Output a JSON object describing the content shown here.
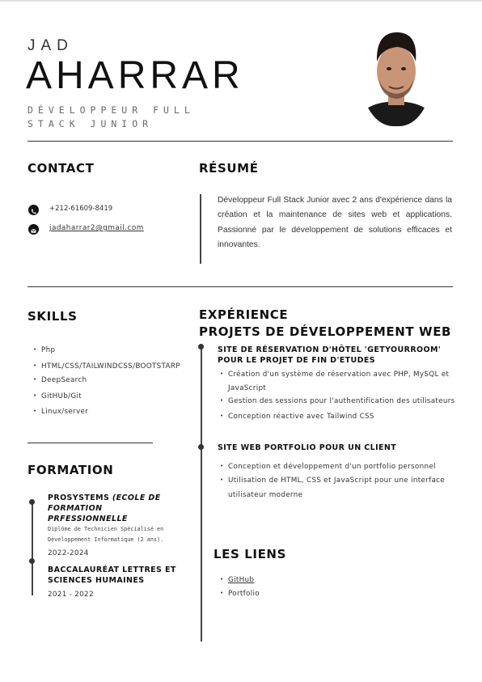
{
  "header": {
    "first_name": "JAD",
    "last_name": "AHARRAR",
    "role_line1": "DÉVELOPPEUR FULL",
    "role_line2": "STACK JUNIOR"
  },
  "contact": {
    "title": "CONTACT",
    "phone": "+212-61609-8419",
    "email": "jadaharrar2@gmail.com"
  },
  "resume": {
    "title": "RÉSUMÉ",
    "text": "Développeur Full Stack Junior avec 2 ans d'expérience dans la création et la maintenance de sites web et applications. Passionné par le développement de solutions efficaces et innovantes."
  },
  "skills": {
    "title": "SKILLS",
    "items": [
      "Php",
      "HTML/CSS/TAILWINDCSS/BOOTSTARP",
      "DeepSearch",
      "GitHUb/Git",
      "Linux/server"
    ]
  },
  "formation": {
    "title": "FORMATION",
    "entries": [
      {
        "school": "PROSYSTEMS",
        "school_extra_1": "(ECOLE DE",
        "school_extra_2": "FORMATION",
        "school_extra_3": "PRFESSIONNELLE",
        "desc_1": "Diplôme de Technicien Spécialisé en",
        "desc_2": "Développement Informatique (2 ans).",
        "years": "2022-2024"
      },
      {
        "school_1": "BACCALAURÉAT LETTRES ET",
        "school_2": "SCIENCES HUMAINES",
        "years": "2021 - 2022"
      }
    ]
  },
  "experience": {
    "title": "EXPÉRIENCE",
    "subtitle": "PROJETS DE DÉVELOPPEMENT WEB",
    "projects": [
      {
        "title_1": "SITE DE RÉSERVATION D'HÔTEL 'GETYOURROOM'",
        "title_2": "POUR LE PROJET DE FIN D'ETUDES",
        "bullets": [
          "Création d'un système de réservation avec PHP, MySQL et",
          "JavaScript",
          "Gestion des sessions pour l'authentification des utilisateurs",
          "Conception réactive avec Tailwind CSS"
        ]
      },
      {
        "title_1": "SITE WEB PORTFOLIO POUR UN CLIENT",
        "bullets": [
          "Conception et développement d'un portfolio personnel",
          "Utilisation de HTML, CSS et JavaScript pour une interface",
          "utilisateur moderne"
        ]
      }
    ]
  },
  "links": {
    "title": "LES LIENS",
    "items": [
      "GitHub",
      "Portfolio"
    ]
  },
  "colors": {
    "text": "#222222",
    "accent": "#111111",
    "muted": "#6a6a6a"
  },
  "icons": {
    "phone": "phone-icon",
    "email": "email-icon"
  }
}
